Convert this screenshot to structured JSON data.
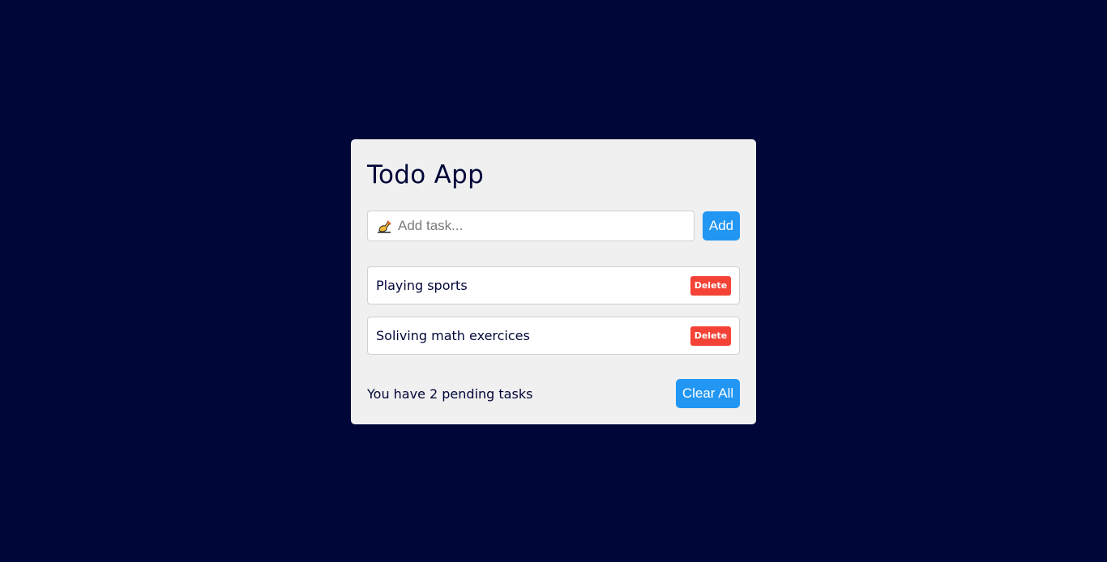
{
  "app": {
    "title": "Todo App"
  },
  "input": {
    "placeholder": "Add task...",
    "value": "",
    "add_label": "Add",
    "icon": "writing-hand-icon"
  },
  "tasks": [
    {
      "text": "Playing sports",
      "delete_label": "Delete"
    },
    {
      "text": "Soliving math exercices",
      "delete_label": "Delete"
    }
  ],
  "footer": {
    "pending_text": "You have 2 pending tasks",
    "clear_label": "Clear All"
  },
  "colors": {
    "background": "#000638",
    "card": "#f0f0f0",
    "primary": "#2196f3",
    "danger": "#f44336"
  }
}
